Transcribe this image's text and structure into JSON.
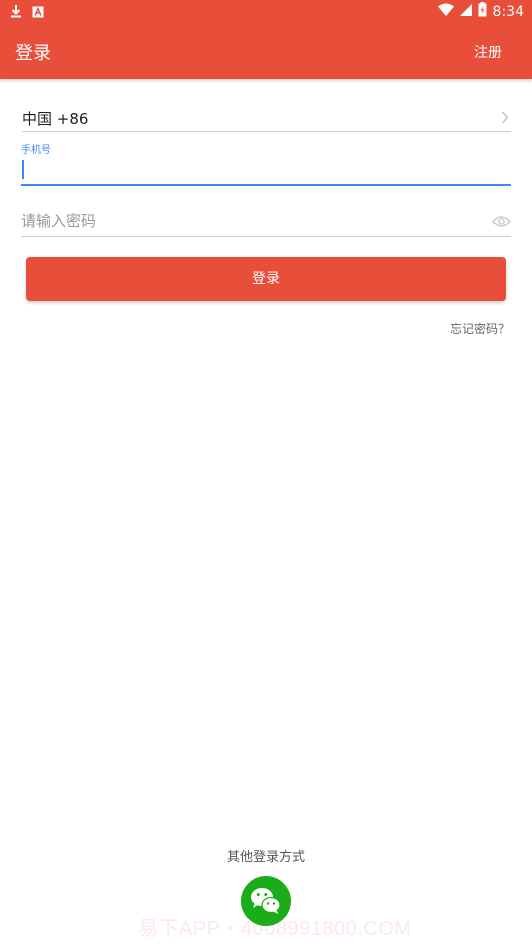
{
  "colors": {
    "accent": "#e94e3a",
    "focus": "#3f86f5",
    "wechat": "#1aad19"
  },
  "status_bar": {
    "time": "8:34",
    "icons": [
      "download-icon",
      "notification-a-icon",
      "wifi-icon",
      "signal-icon",
      "battery-icon"
    ]
  },
  "header": {
    "title": "登录",
    "register_label": "注册"
  },
  "form": {
    "country": "中国 +86",
    "phone_label": "手机号",
    "phone_value": "",
    "password_placeholder": "请输入密码",
    "login_label": "登录",
    "forgot_label": "忘记密码？"
  },
  "other_login": {
    "title": "其他登录方式",
    "icons": [
      "wechat-icon"
    ]
  },
  "watermark": "易下APP・4008991800.COM"
}
